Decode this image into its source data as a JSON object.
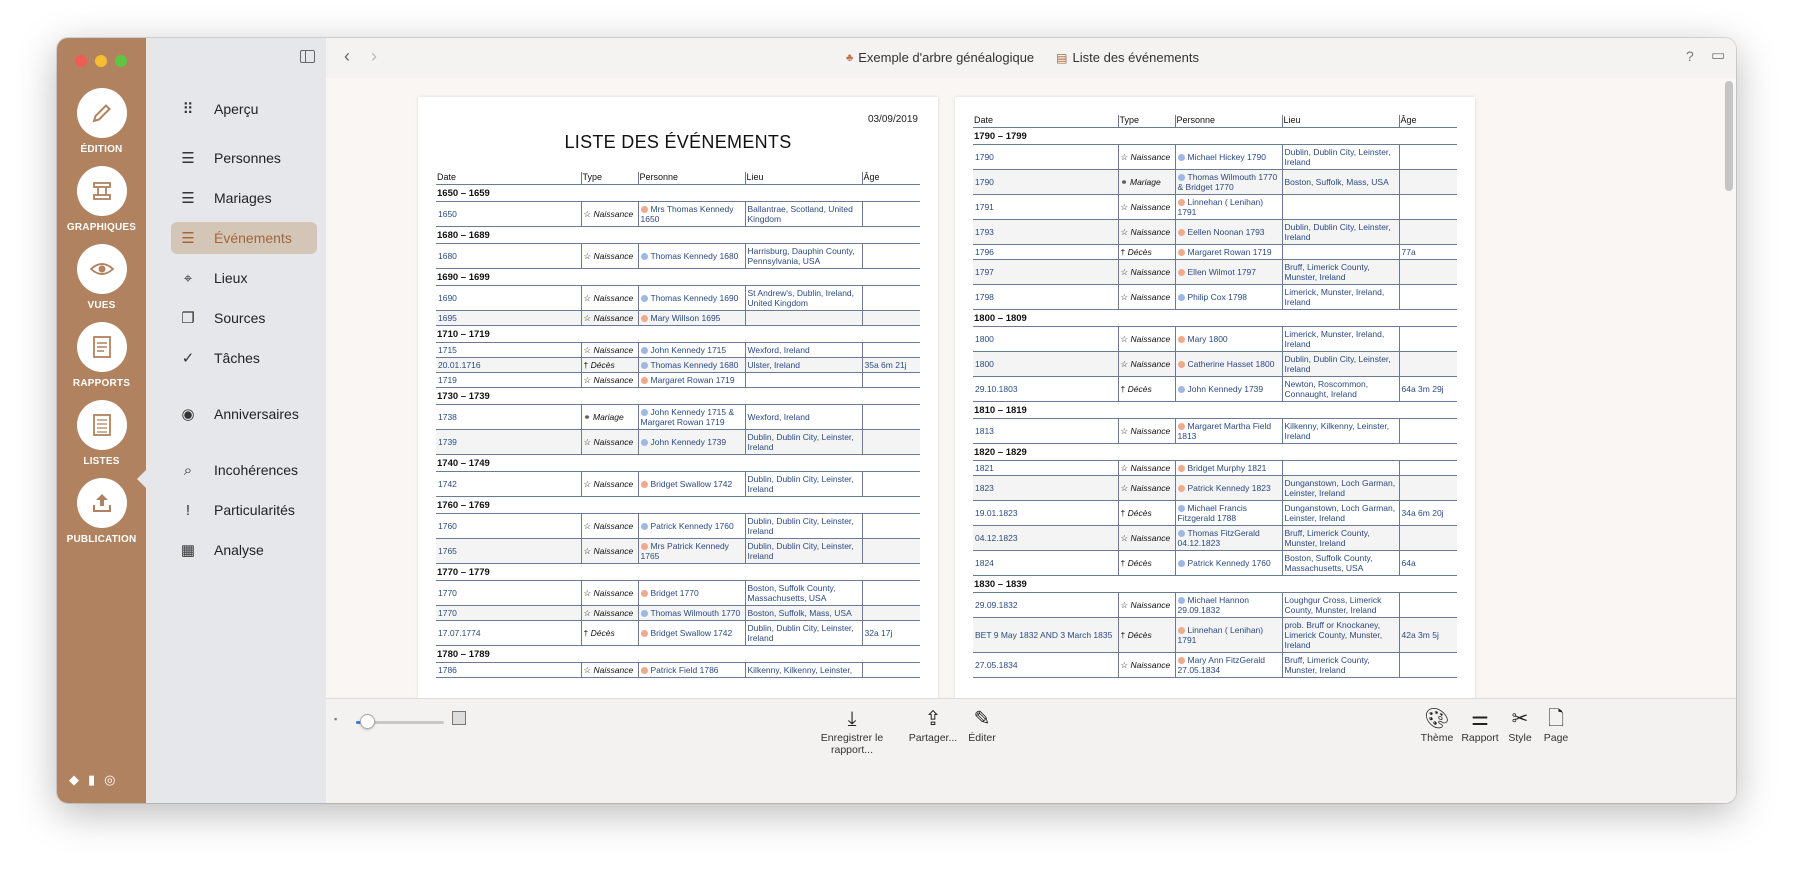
{
  "rail": {
    "items": [
      {
        "label": "ÉDITION",
        "icon": "pencil-icon"
      },
      {
        "label": "GRAPHIQUES",
        "icon": "chart-icon"
      },
      {
        "label": "VUES",
        "icon": "eye-icon"
      },
      {
        "label": "RAPPORTS",
        "icon": "report-icon"
      },
      {
        "label": "LISTES",
        "icon": "list-icon"
      },
      {
        "label": "PUBLICATION",
        "icon": "upload-icon"
      }
    ],
    "bottom_icons": [
      "◆",
      "▮",
      "◎"
    ]
  },
  "sidebar": {
    "items": [
      {
        "label": "Aperçu",
        "icon": "⠿"
      },
      {
        "label": "Personnes",
        "icon": "☰"
      },
      {
        "label": "Mariages",
        "icon": "☰"
      },
      {
        "label": "Événements",
        "icon": "☰"
      },
      {
        "label": "Lieux",
        "icon": "⌖"
      },
      {
        "label": "Sources",
        "icon": "❐"
      },
      {
        "label": "Tâches",
        "icon": "✓"
      },
      {
        "label": "Anniversaires",
        "icon": "◉"
      },
      {
        "label": "Incohérences",
        "icon": "⌕"
      },
      {
        "label": "Particularités",
        "icon": "!"
      },
      {
        "label": "Analyse",
        "icon": "▦"
      }
    ]
  },
  "topbar": {
    "back": "‹",
    "forward": "›",
    "crumb1": "Exemple d'arbre généalogique",
    "crumb1_icon": "♣",
    "crumb2": "Liste des événements",
    "crumb2_icon": "▤",
    "help": "?",
    "window_icon": "▭"
  },
  "doc": {
    "date": "03/09/2019",
    "title": "LISTE DES ÉVÉNEMENTS",
    "columns": [
      "Date",
      "Type",
      "Personne",
      "Lieu",
      "Âge"
    ],
    "page1": [
      {
        "decade": "1650 – 1659"
      },
      {
        "date": "1650",
        "type": "Naissance",
        "mark": "☆",
        "sex": "f",
        "person": "Mrs Thomas Kennedy 1650",
        "place": "Ballantrae, Scotland, United Kingdom",
        "age": ""
      },
      {
        "decade": "1680 – 1689"
      },
      {
        "date": "1680",
        "type": "Naissance",
        "mark": "☆",
        "sex": "m",
        "person": "Thomas Kennedy 1680",
        "place": "Harrisburg, Dauphin County, Pennsylvania, USA",
        "age": ""
      },
      {
        "decade": "1690 – 1699"
      },
      {
        "date": "1690",
        "type": "Naissance",
        "mark": "☆",
        "sex": "m",
        "person": "Thomas Kennedy 1690",
        "place": "St Andrew's, Dublin, Ireland, United Kingdom",
        "age": ""
      },
      {
        "date": "1695",
        "type": "Naissance",
        "mark": "☆",
        "sex": "f",
        "person": "Mary Willson 1695",
        "place": "",
        "age": ""
      },
      {
        "decade": "1710 – 1719"
      },
      {
        "date": "1715",
        "type": "Naissance",
        "mark": "☆",
        "sex": "m",
        "person": "John Kennedy 1715",
        "place": "Wexford, Ireland",
        "age": ""
      },
      {
        "date": "20.01.1716",
        "type": "Décès",
        "mark": "†",
        "sex": "m",
        "person": "Thomas Kennedy 1680",
        "place": "Ulster, Ireland",
        "age": "35a 6m 21j"
      },
      {
        "date": "1719",
        "type": "Naissance",
        "mark": "☆",
        "sex": "f",
        "person": "Margaret Rowan 1719",
        "place": "",
        "age": ""
      },
      {
        "decade": "1730 – 1739"
      },
      {
        "date": "1738",
        "type": "Mariage",
        "mark": "⚭",
        "sex": "mf",
        "person": "John Kennedy 1715 & Margaret Rowan 1719",
        "place": "Wexford, Ireland",
        "age": ""
      },
      {
        "date": "1739",
        "type": "Naissance",
        "mark": "☆",
        "sex": "m",
        "person": "John Kennedy 1739",
        "place": "Dublin, Dublin City, Leinster, Ireland",
        "age": ""
      },
      {
        "decade": "1740 – 1749"
      },
      {
        "date": "1742",
        "type": "Naissance",
        "mark": "☆",
        "sex": "f",
        "person": "Bridget Swallow 1742",
        "place": "Dublin, Dublin City, Leinster, Ireland",
        "age": ""
      },
      {
        "decade": "1760 – 1769"
      },
      {
        "date": "1760",
        "type": "Naissance",
        "mark": "☆",
        "sex": "m",
        "person": "Patrick Kennedy 1760",
        "place": "Dublin, Dublin City, Leinster, Ireland",
        "age": ""
      },
      {
        "date": "1765",
        "type": "Naissance",
        "mark": "☆",
        "sex": "f",
        "person": "Mrs Patrick Kennedy 1765",
        "place": "Dublin, Dublin City, Leinster, Ireland",
        "age": ""
      },
      {
        "decade": "1770 – 1779"
      },
      {
        "date": "1770",
        "type": "Naissance",
        "mark": "☆",
        "sex": "f",
        "person": "Bridget 1770",
        "place": "Boston, Suffolk County, Massachusetts, USA",
        "age": ""
      },
      {
        "date": "1770",
        "type": "Naissance",
        "mark": "☆",
        "sex": "m",
        "person": "Thomas Wilmouth 1770",
        "place": "Boston, Suffolk, Mass, USA",
        "age": ""
      },
      {
        "date": "17.07.1774",
        "type": "Décès",
        "mark": "†",
        "sex": "f",
        "person": "Bridget Swallow 1742",
        "place": "Dublin, Dublin City, Leinster, Ireland",
        "age": "32a 17j"
      },
      {
        "decade": "1780 – 1789"
      },
      {
        "date": "1786",
        "type": "Naissance",
        "mark": "☆",
        "sex": "f",
        "person": "Patrick Field 1786",
        "place": "Kilkenny, Kilkenny, Leinster,",
        "age": ""
      }
    ],
    "page2": [
      {
        "decade": "1790 – 1799"
      },
      {
        "date": "1790",
        "type": "Naissance",
        "mark": "☆",
        "sex": "m",
        "person": "Michael Hickey 1790",
        "place": "Dublin, Dublin City, Leinster, Ireland",
        "age": ""
      },
      {
        "date": "1790",
        "type": "Mariage",
        "mark": "⚭",
        "sex": "mf",
        "person": "Thomas Wilmouth 1770 & Bridget 1770",
        "place": "Boston, Suffolk, Mass, USA",
        "age": ""
      },
      {
        "date": "1791",
        "type": "Naissance",
        "mark": "☆",
        "sex": "f",
        "person": "Linnehan ( Lenihan) 1791",
        "place": "",
        "age": ""
      },
      {
        "date": "1793",
        "type": "Naissance",
        "mark": "☆",
        "sex": "f",
        "person": "Eellen Noonan 1793",
        "place": "Dublin, Dublin City, Leinster, Ireland",
        "age": ""
      },
      {
        "date": "1796",
        "type": "Décès",
        "mark": "†",
        "sex": "f",
        "person": "Margaret Rowan 1719",
        "place": "",
        "age": "77a"
      },
      {
        "date": "1797",
        "type": "Naissance",
        "mark": "☆",
        "sex": "f",
        "person": "Ellen Wilmot 1797",
        "place": "Bruff, Limerick County, Munster, Ireland",
        "age": ""
      },
      {
        "date": "1798",
        "type": "Naissance",
        "mark": "☆",
        "sex": "m",
        "person": "Philip Cox 1798",
        "place": "Limerick, Munster, Ireland, Ireland",
        "age": ""
      },
      {
        "decade": "1800 – 1809"
      },
      {
        "date": "1800",
        "type": "Naissance",
        "mark": "☆",
        "sex": "f",
        "person": "Mary 1800",
        "place": "Limerick, Munster, Ireland, Ireland",
        "age": ""
      },
      {
        "date": "1800",
        "type": "Naissance",
        "mark": "☆",
        "sex": "f",
        "person": "Catherine Hasset 1800",
        "place": "Dublin, Dublin City, Leinster, Ireland",
        "age": ""
      },
      {
        "date": "29.10.1803",
        "type": "Décès",
        "mark": "†",
        "sex": "m",
        "person": "John Kennedy 1739",
        "place": "Newton, Roscommon, Connaught, Ireland",
        "age": "64a 3m 29j"
      },
      {
        "decade": "1810 – 1819"
      },
      {
        "date": "1813",
        "type": "Naissance",
        "mark": "☆",
        "sex": "f",
        "person": "Margaret Martha Field 1813",
        "place": "Kilkenny, Kilkenny, Leinster, Ireland",
        "age": ""
      },
      {
        "decade": "1820 – 1829"
      },
      {
        "date": "1821",
        "type": "Naissance",
        "mark": "☆",
        "sex": "f",
        "person": "Bridget Murphy 1821",
        "place": "",
        "age": ""
      },
      {
        "date": "1823",
        "type": "Naissance",
        "mark": "☆",
        "sex": "f",
        "person": "Patrick Kennedy 1823",
        "place": "Dunganstown, Loch Garman, Leinster, Ireland",
        "age": ""
      },
      {
        "date": "19.01.1823",
        "type": "Décès",
        "mark": "†",
        "sex": "m",
        "person": "Michael Francis Fitzgerald 1788",
        "place": "Dunganstown, Loch Garman, Leinster, Ireland",
        "age": "34a 6m 20j"
      },
      {
        "date": "04.12.1823",
        "type": "Naissance",
        "mark": "☆",
        "sex": "m",
        "person": "Thomas FitzGerald 04.12.1823",
        "place": "Bruff, Limerick County, Munster, Ireland",
        "age": ""
      },
      {
        "date": "1824",
        "type": "Décès",
        "mark": "†",
        "sex": "m",
        "person": "Patrick Kennedy 1760",
        "place": "Boston, Suffolk County, Massachusetts, USA",
        "age": "64a"
      },
      {
        "decade": "1830 – 1839"
      },
      {
        "date": "29.09.1832",
        "type": "Naissance",
        "mark": "☆",
        "sex": "m",
        "person": "Michael Hannon 29.09.1832",
        "place": "Loughgur Cross, Limerick County, Munster, Ireland",
        "age": ""
      },
      {
        "date": "BET 9 May 1832 AND 3 March 1835",
        "type": "Décès",
        "mark": "†",
        "sex": "f",
        "person": "Linnehan ( Lenihan) 1791",
        "place": "prob. Bruff or Knockaney, Limerick County, Munster, Ireland",
        "age": "42a 3m 5j"
      },
      {
        "date": "27.05.1834",
        "type": "Naissance",
        "mark": "☆",
        "sex": "f",
        "person": "Mary Ann FitzGerald 27.05.1834",
        "place": "Bruff, Limerick County, Munster, Ireland",
        "age": ""
      }
    ]
  },
  "bottombar": {
    "save": "Enregistrer le rapport...",
    "share": "Partager...",
    "edit": "Éditer",
    "theme": "Thème",
    "report": "Rapport",
    "style": "Style",
    "page": "Page",
    "zoom": 0.12
  }
}
